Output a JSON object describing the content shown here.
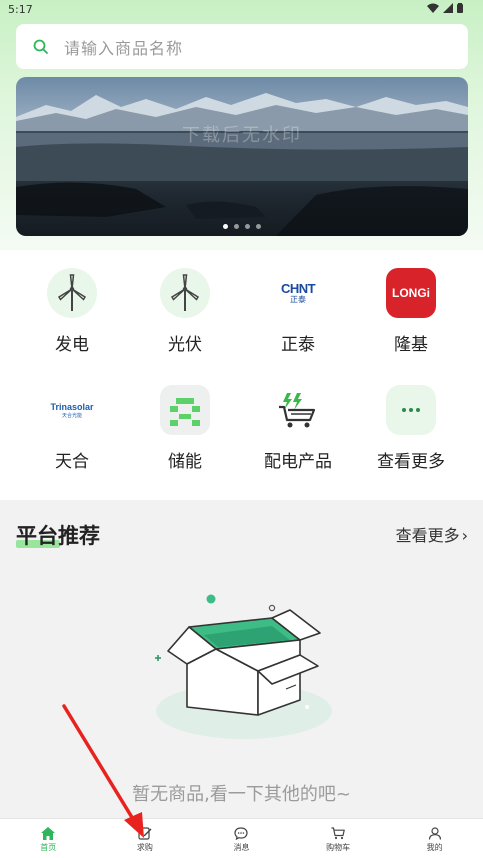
{
  "status_bar": {
    "time": "5:17"
  },
  "search": {
    "placeholder": "请输入商品名称"
  },
  "banner": {
    "watermark": "下载后无水印",
    "dots": 4,
    "active_dot": 0
  },
  "categories": [
    {
      "label": "发电",
      "icon": "wind-turbine-icon"
    },
    {
      "label": "光伏",
      "icon": "wind-turbine-icon"
    },
    {
      "label": "正泰",
      "icon": "chint-logo",
      "logo_top": "CHNT",
      "logo_bottom": "正泰"
    },
    {
      "label": "隆基",
      "icon": "longi-logo",
      "logo_text": "LONGi"
    },
    {
      "label": "天合",
      "icon": "trinasolar-logo",
      "logo_text": "Trinasolar",
      "logo_sub": "天合光能"
    },
    {
      "label": "储能",
      "icon": "energy-storage-icon"
    },
    {
      "label": "配电产品",
      "icon": "charging-cart-icon"
    },
    {
      "label": "查看更多",
      "icon": "more-dots-icon"
    }
  ],
  "recommend": {
    "title": "平台推荐",
    "more": "查看更多",
    "more_chevron": "›"
  },
  "empty_state": {
    "text": "暂无商品,看一下其他的吧~"
  },
  "tabbar": [
    {
      "label": "首页",
      "icon": "home-icon",
      "active": true
    },
    {
      "label": "求购",
      "icon": "edit-icon",
      "active": false
    },
    {
      "label": "消息",
      "icon": "chat-icon",
      "active": false
    },
    {
      "label": "购物车",
      "icon": "cart-icon",
      "active": false
    },
    {
      "label": "我的",
      "icon": "user-icon",
      "active": false
    }
  ],
  "colors": {
    "accent": "#2eb65a",
    "longi_red": "#d8232a",
    "chint_blue": "#1a4aa0"
  }
}
